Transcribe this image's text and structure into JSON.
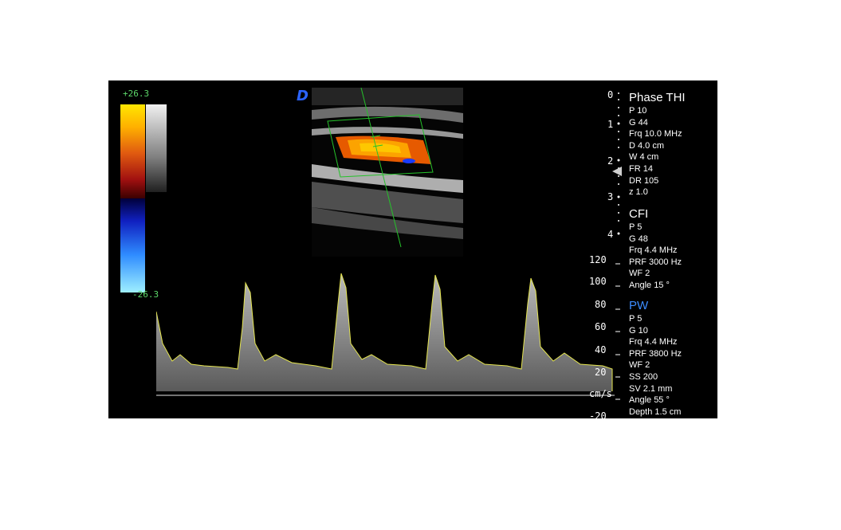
{
  "colorbar": {
    "top": "+26.3",
    "bottom": "-26.3"
  },
  "logo": "D",
  "depth_scale": [
    "0",
    "1",
    "2",
    "3",
    "4"
  ],
  "velocity_scale": {
    "ticks": [
      "120",
      "100",
      "80",
      "60",
      "40",
      "20",
      "-20"
    ],
    "unit": "cm/s"
  },
  "phase_thi": {
    "title": "Phase THI",
    "lines": [
      "P 10",
      "G 44",
      "Frq 10.0 MHz",
      "D 4.0 cm",
      "W  4 cm",
      "FR 14",
      "DR 105",
      "z 1.0"
    ]
  },
  "cfi": {
    "title": "CFI",
    "lines": [
      "P 5",
      "G 48",
      "Frq 4.4 MHz",
      "PRF 3000 Hz",
      "WF 2",
      "Angle 15 °"
    ]
  },
  "pw": {
    "title": "PW",
    "lines": [
      "P 5",
      "G 10",
      "Frq 4.4 MHz",
      "PRF 3800 Hz",
      "WF 2",
      "SS 200",
      "SV 2.1 mm",
      "Angle 55 °",
      "Depth 1.5 cm"
    ]
  },
  "colors": {
    "pw_title": "#3c8cff",
    "colorbar_text": "#5dd86a",
    "envelope": "#e6e650",
    "gate": "#25c22a"
  }
}
